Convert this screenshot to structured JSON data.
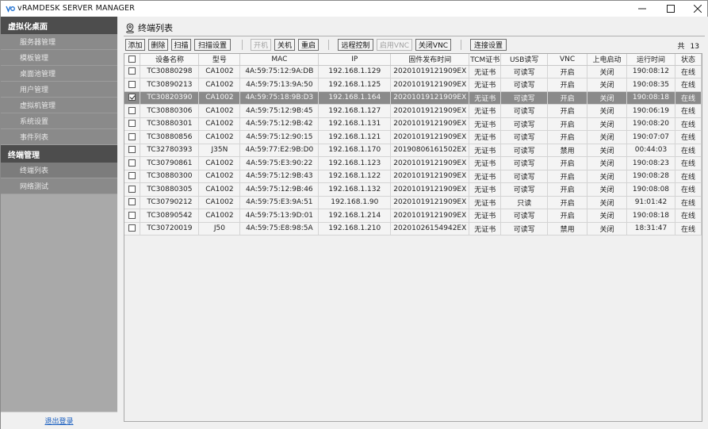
{
  "window": {
    "title": "vRAMDESK SERVER MANAGER"
  },
  "sidebar": {
    "sections": [
      {
        "label": "虚拟化桌面",
        "items": [
          "服务器管理",
          "模板管理",
          "桌面池管理",
          "用户管理",
          "虚拟机管理",
          "系统设置",
          "事件列表"
        ]
      },
      {
        "label": "终端管理",
        "items": [
          "终端列表",
          "网络测试"
        ]
      }
    ],
    "logout": "退出登录"
  },
  "page": {
    "title": "终端列表"
  },
  "toolbar": {
    "add": "添加",
    "delete": "删除",
    "scan": "扫描",
    "scan_settings": "扫描设置",
    "power_on": "开机",
    "power_off": "关机",
    "restart": "重启",
    "remote_control": "远程控制",
    "enable_vnc": "启用VNC",
    "disable_vnc": "关闭VNC",
    "connection_settings": "连接设置",
    "count_label": "共",
    "count_value": "13"
  },
  "table": {
    "headers": [
      "设备名称",
      "型号",
      "MAC",
      "IP",
      "固件发布时间",
      "TCM证书",
      "USB读写",
      "VNC",
      "上电启动",
      "运行时间",
      "状态"
    ],
    "rows": [
      {
        "checked": false,
        "selected": false,
        "cells": [
          "TC30880298",
          "CA1002",
          "4A:59:75:12:9A:DB",
          "192.168.1.129",
          "20201019121909EX",
          "无证书",
          "可读写",
          "开启",
          "关闭",
          "190:08:12",
          "在线"
        ]
      },
      {
        "checked": false,
        "selected": false,
        "cells": [
          "TC30890213",
          "CA1002",
          "4A:59:75:13:9A:50",
          "192.168.1.125",
          "20201019121909EX",
          "无证书",
          "可读写",
          "开启",
          "关闭",
          "190:08:35",
          "在线"
        ]
      },
      {
        "checked": true,
        "selected": true,
        "cells": [
          "TC30820390",
          "CA1002",
          "4A:59:75:18:9B:D3",
          "192.168.1.164",
          "20201019121909EX",
          "无证书",
          "可读写",
          "开启",
          "关闭",
          "190:08:18",
          "在线"
        ]
      },
      {
        "checked": false,
        "selected": false,
        "cells": [
          "TC30880306",
          "CA1002",
          "4A:59:75:12:9B:45",
          "192.168.1.127",
          "20201019121909EX",
          "无证书",
          "可读写",
          "开启",
          "关闭",
          "190:06:19",
          "在线"
        ]
      },
      {
        "checked": false,
        "selected": false,
        "cells": [
          "TC30880301",
          "CA1002",
          "4A:59:75:12:9B:42",
          "192.168.1.131",
          "20201019121909EX",
          "无证书",
          "可读写",
          "开启",
          "关闭",
          "190:08:20",
          "在线"
        ]
      },
      {
        "checked": false,
        "selected": false,
        "cells": [
          "TC30880856",
          "CA1002",
          "4A:59:75:12:90:15",
          "192.168.1.121",
          "20201019121909EX",
          "无证书",
          "可读写",
          "开启",
          "关闭",
          "190:07:07",
          "在线"
        ]
      },
      {
        "checked": false,
        "selected": false,
        "cells": [
          "TC32780393",
          "J35N",
          "4A:59:77:E2:9B:D0",
          "192.168.1.170",
          "20190806161502EX",
          "无证书",
          "可读写",
          "禁用",
          "关闭",
          "00:44:03",
          "在线"
        ]
      },
      {
        "checked": false,
        "selected": false,
        "cells": [
          "TC30790861",
          "CA1002",
          "4A:59:75:E3:90:22",
          "192.168.1.123",
          "20201019121909EX",
          "无证书",
          "可读写",
          "开启",
          "关闭",
          "190:08:23",
          "在线"
        ]
      },
      {
        "checked": false,
        "selected": false,
        "cells": [
          "TC30880300",
          "CA1002",
          "4A:59:75:12:9B:43",
          "192.168.1.122",
          "20201019121909EX",
          "无证书",
          "可读写",
          "开启",
          "关闭",
          "190:08:28",
          "在线"
        ]
      },
      {
        "checked": false,
        "selected": false,
        "cells": [
          "TC30880305",
          "CA1002",
          "4A:59:75:12:9B:46",
          "192.168.1.132",
          "20201019121909EX",
          "无证书",
          "可读写",
          "开启",
          "关闭",
          "190:08:08",
          "在线"
        ]
      },
      {
        "checked": false,
        "selected": false,
        "cells": [
          "TC30790212",
          "CA1002",
          "4A:59:75:E3:9A:51",
          "192.168.1.90",
          "20201019121909EX",
          "无证书",
          "只读",
          "开启",
          "关闭",
          "91:01:42",
          "在线"
        ]
      },
      {
        "checked": false,
        "selected": false,
        "cells": [
          "TC30890542",
          "CA1002",
          "4A:59:75:13:9D:01",
          "192.168.1.214",
          "20201019121909EX",
          "无证书",
          "可读写",
          "开启",
          "关闭",
          "190:08:18",
          "在线"
        ]
      },
      {
        "checked": false,
        "selected": false,
        "cells": [
          "TC30720019",
          "J50",
          "4A:59:75:E8:98:5A",
          "192.168.1.210",
          "20201026154942EX",
          "无证书",
          "可读写",
          "禁用",
          "关闭",
          "18:31:47",
          "在线"
        ]
      }
    ]
  }
}
